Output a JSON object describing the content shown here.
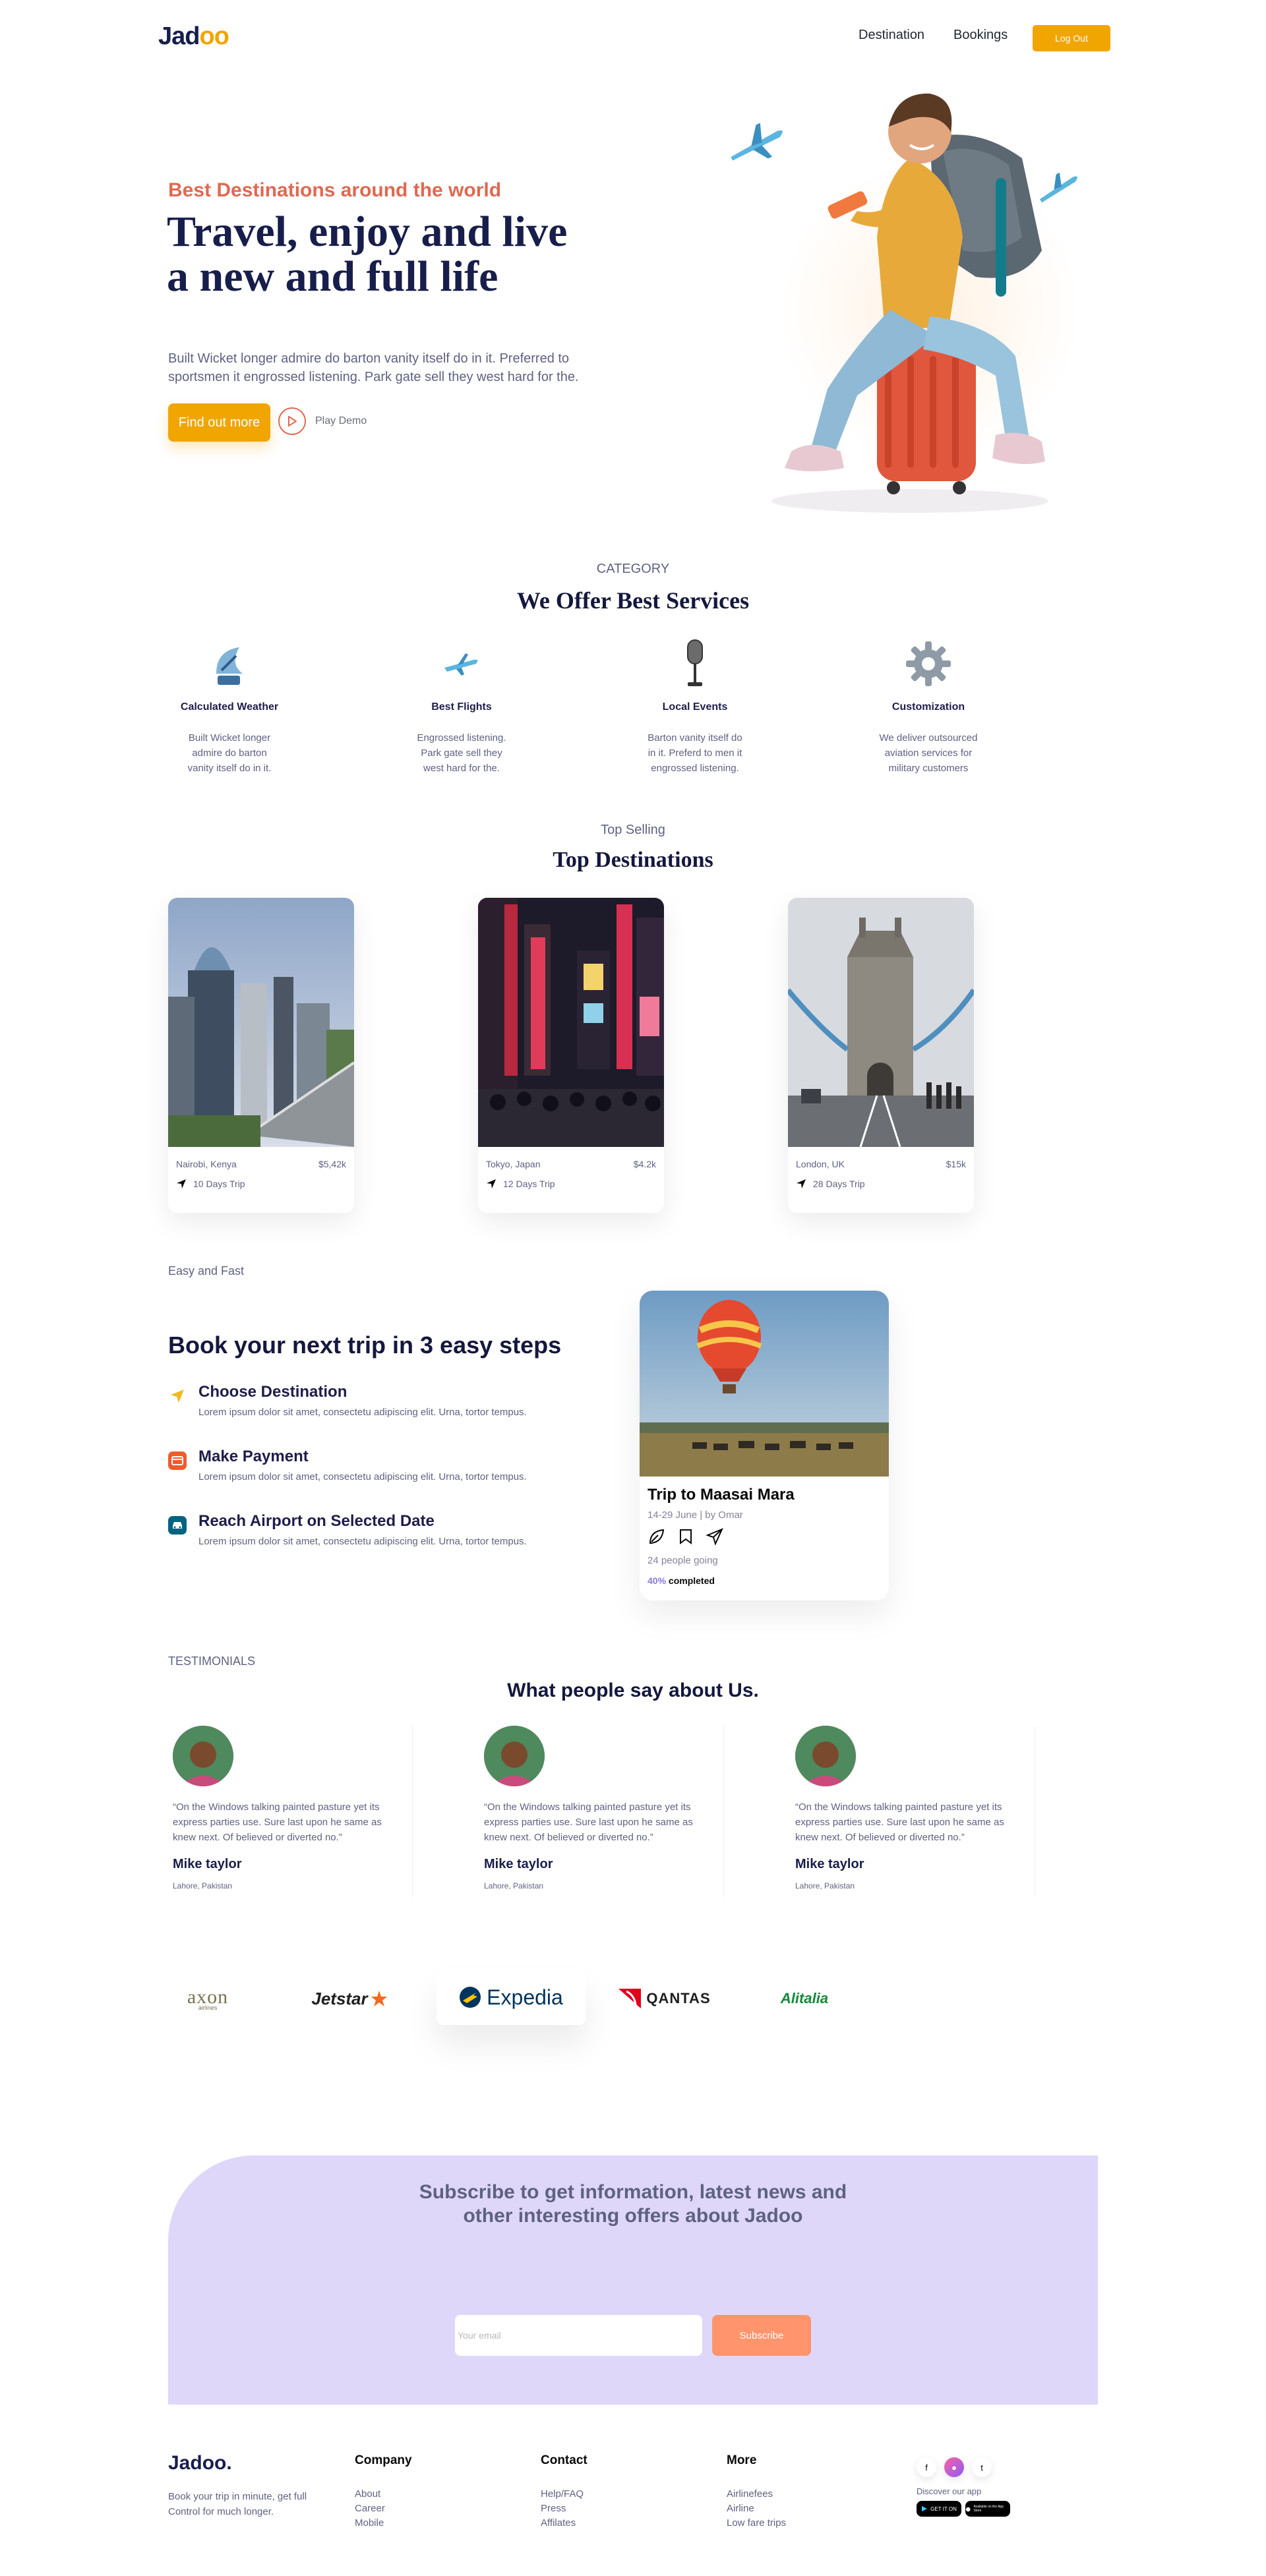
{
  "nav": {
    "logo": "Jad",
    "logo_accent": "oo",
    "links": [
      "Destination",
      "Bookings"
    ],
    "logout": "Log Out"
  },
  "hero": {
    "kicker": "Best Destinations around the world",
    "title": "Travel, enjoy and live a new and full life",
    "description": "Built Wicket longer admire do barton vanity itself do in it. Preferred to sportsmen it engrossed listening. Park gate sell they west hard for the.",
    "cta": "Find out more",
    "play": "Play Demo"
  },
  "services": {
    "kicker": "CATEGORY",
    "title": "We Offer Best Services",
    "items": [
      {
        "title": "Calculated Weather",
        "desc": "Built Wicket longer admire do barton vanity itself do in it.",
        "icon": "satellite-dish-icon"
      },
      {
        "title": "Best Flights",
        "desc": "Engrossed listening. Park gate sell they west hard for the.",
        "icon": "airplane-icon"
      },
      {
        "title": "Local Events",
        "desc": "Barton vanity itself do in it. Preferd to men it engrossed listening.",
        "icon": "microphone-icon"
      },
      {
        "title": "Customization",
        "desc": "We deliver outsourced aviation services for military customers",
        "icon": "gear-icon"
      }
    ]
  },
  "destinations": {
    "kicker": "Top Selling",
    "title": "Top Destinations",
    "items": [
      {
        "place": "Nairobi, Kenya",
        "price": "$5,42k",
        "trip": "10 Days Trip"
      },
      {
        "place": "Tokyo, Japan",
        "price": "$4.2k",
        "trip": "12 Days Trip"
      },
      {
        "place": "London, UK",
        "price": "$15k",
        "trip": "28 Days Trip"
      }
    ]
  },
  "steps": {
    "kicker": "Easy and Fast",
    "title": "Book your next trip in 3 easy steps",
    "items": [
      {
        "title": "Choose Destination",
        "desc": "Lorem ipsum dolor sit amet, consectetu adipiscing elit. Urna, tortor tempus.",
        "color": "#F0BB1F"
      },
      {
        "title": "Make Payment",
        "desc": "Lorem ipsum dolor sit amet, consectetu adipiscing elit. Urna, tortor tempus.",
        "color": "#F15A2B"
      },
      {
        "title": "Reach Airport on Selected Date",
        "desc": "Lorem ipsum dolor sit amet, consectetu adipiscing elit. Urna, tortor tempus.",
        "color": "#006380"
      }
    ],
    "trip": {
      "name": "Trip to Maasai Mara",
      "meta": "14-29 June | by Omar",
      "going": "24 people going",
      "pct": "40%",
      "completed": "completed"
    }
  },
  "testimonials": {
    "kicker": "TESTIMONIALS",
    "title": "What people say about Us.",
    "items": [
      {
        "quote": "“On the Windows talking painted pasture yet its express parties use. Sure last upon he same as knew next. Of believed or diverted no.”",
        "name": "Mike taylor",
        "location": "Lahore, Pakistan"
      },
      {
        "quote": "“On the Windows talking painted pasture yet its express parties use. Sure last upon he same as knew next. Of believed or diverted no.”",
        "name": "Mike taylor",
        "location": "Lahore, Pakistan"
      },
      {
        "quote": "“On the Windows talking painted pasture yet its express parties use. Sure last upon he same as knew next. Of believed or diverted no.”",
        "name": "Mike taylor",
        "location": "Lahore, Pakistan"
      }
    ]
  },
  "partners": {
    "axon": "axon",
    "axon_sub": "airlines",
    "jetstar": "Jetstar",
    "expedia": "Expedia",
    "qantas": "QANTAS",
    "alitalia": "Alitalia"
  },
  "subscribe": {
    "text": "Subscribe to get information, latest news and other interesting offers about Jadoo",
    "placeholder": "Your email",
    "button": "Subscribe"
  },
  "footer": {
    "brand": "Jadoo.",
    "tagline": "Book your trip in minute, get full Control for much longer.",
    "columns": [
      {
        "head": "Company",
        "links": [
          "About",
          "Career",
          "Mobile"
        ]
      },
      {
        "head": "Contact",
        "links": [
          "Help/FAQ",
          "Press",
          "Affilates"
        ]
      },
      {
        "head": "More",
        "links": [
          "Airlinefees",
          "Airline",
          "Low fare trips"
        ]
      }
    ],
    "social": [
      "f",
      "●",
      "t"
    ],
    "discover": "Discover our app",
    "stores": [
      "GET IT ON",
      "Available on the App Store"
    ]
  }
}
